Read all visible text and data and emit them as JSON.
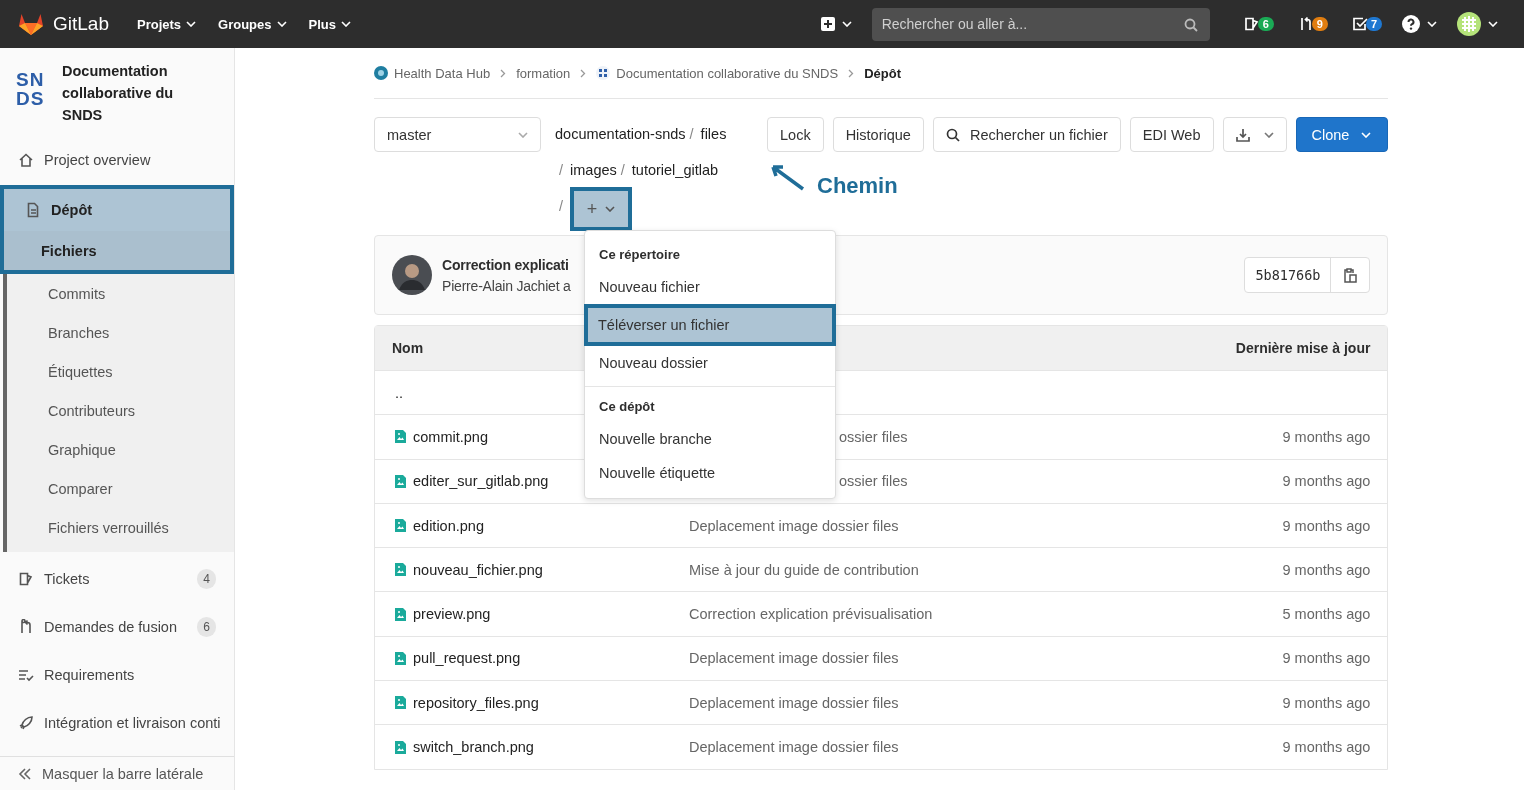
{
  "topbar": {
    "brand": "GitLab",
    "menus": [
      {
        "label": "Projets"
      },
      {
        "label": "Groupes"
      },
      {
        "label": "Plus"
      }
    ],
    "search": {
      "placeholder": "Rechercher ou aller à..."
    },
    "counters": [
      {
        "kind": "issues",
        "count": "6",
        "color": "#1aaa55"
      },
      {
        "kind": "merge",
        "count": "9",
        "color": "#e07d10"
      },
      {
        "kind": "todo",
        "count": "7",
        "color": "#1f78d1"
      }
    ]
  },
  "sidebar": {
    "project": {
      "logo_lines": [
        "SN",
        "DS"
      ],
      "name": "Documentation collaborative du SNDS"
    },
    "items": [
      {
        "kind": "overview",
        "label": "Project overview",
        "selected": false,
        "highlighted": false
      },
      {
        "kind": "repository",
        "label": "Dépôt",
        "selected": true,
        "highlighted": true,
        "children": [
          {
            "label": "Fichiers",
            "selected": true
          },
          {
            "label": "Commits",
            "selected": false
          },
          {
            "label": "Branches",
            "selected": false
          },
          {
            "label": "Étiquettes",
            "selected": false
          },
          {
            "label": "Contributeurs",
            "selected": false
          },
          {
            "label": "Graphique",
            "selected": false
          },
          {
            "label": "Comparer",
            "selected": false
          },
          {
            "label": "Fichiers verrouillés",
            "selected": false
          }
        ]
      },
      {
        "kind": "issues",
        "label": "Tickets",
        "badge": "4",
        "selected": false,
        "highlighted": false
      },
      {
        "kind": "merge",
        "label": "Demandes de fusion",
        "badge": "6",
        "selected": false,
        "highlighted": false
      },
      {
        "kind": "requirements",
        "label": "Requirements",
        "selected": false,
        "highlighted": false
      },
      {
        "kind": "cicd",
        "label": "Intégration et livraison conti",
        "selected": false,
        "highlighted": false
      }
    ],
    "collapse": "Masquer la barre latérale"
  },
  "breadcrumb": [
    {
      "kind": "group",
      "text": "Health Data Hub",
      "current": false
    },
    {
      "kind": "plain",
      "text": "formation",
      "current": false
    },
    {
      "kind": "project",
      "text": "Documentation collaborative du SNDS",
      "current": false
    },
    {
      "kind": "plain",
      "text": "Dépôt",
      "current": true
    }
  ],
  "toolbar": {
    "branch": "master",
    "path": [
      {
        "label": "documentation-snds"
      },
      {
        "separator": "/",
        "label": "files"
      },
      {
        "separator": "/",
        "label": "images"
      },
      {
        "separator": "/",
        "label": "tutoriel_gitlab"
      }
    ],
    "add_button": {
      "separator": "/",
      "label": "+",
      "highlighted": true
    },
    "buttons": [
      {
        "kind": "text",
        "label": "Lock"
      },
      {
        "kind": "text",
        "label": "Historique"
      },
      {
        "kind": "search",
        "label": "Rechercher un fichier"
      },
      {
        "kind": "text",
        "label": "EDI Web"
      },
      {
        "kind": "download"
      },
      {
        "kind": "primary",
        "label": "Clone"
      }
    ]
  },
  "annotation": {
    "label": "Chemin"
  },
  "dropdown": {
    "sections": [
      {
        "title": "Ce répertoire",
        "items": [
          {
            "label": "Nouveau fichier",
            "highlighted": false
          },
          {
            "label": "Téléverser un fichier",
            "highlighted": true
          },
          {
            "label": "Nouveau dossier",
            "highlighted": false
          }
        ]
      },
      {
        "title": "Ce dépôt",
        "items": [
          {
            "label": "Nouvelle branche",
            "highlighted": false
          },
          {
            "label": "Nouvelle étiquette",
            "highlighted": false
          }
        ]
      }
    ]
  },
  "commit": {
    "title": "Correction explicati",
    "author_line": "Pierre-Alain Jachiet a",
    "sha": "5b81766b"
  },
  "table": {
    "columns": [
      "Nom",
      "Dernière mise à jour"
    ],
    "rows": [
      {
        "kind": "parent",
        "name": ".."
      },
      {
        "kind": "file",
        "name": "commit.png",
        "message": "ossier files",
        "updated": "9 months ago"
      },
      {
        "kind": "file",
        "name": "editer_sur_gitlab.png",
        "message": "ossier files",
        "updated": "9 months ago"
      },
      {
        "kind": "file",
        "name": "edition.png",
        "message": "Deplacement image dossier files",
        "updated": "9 months ago"
      },
      {
        "kind": "file",
        "name": "nouveau_fichier.png",
        "message": "Mise à jour du guide de contribution",
        "updated": "9 months ago"
      },
      {
        "kind": "file",
        "name": "preview.png",
        "message": "Correction explication prévisualisation",
        "updated": "5 months ago"
      },
      {
        "kind": "file",
        "name": "pull_request.png",
        "message": "Deplacement image dossier files",
        "updated": "9 months ago"
      },
      {
        "kind": "file",
        "name": "repository_files.png",
        "message": "Deplacement image dossier files",
        "updated": "9 months ago"
      },
      {
        "kind": "file",
        "name": "switch_branch.png",
        "message": "Deplacement image dossier files",
        "updated": "9 months ago"
      }
    ]
  }
}
